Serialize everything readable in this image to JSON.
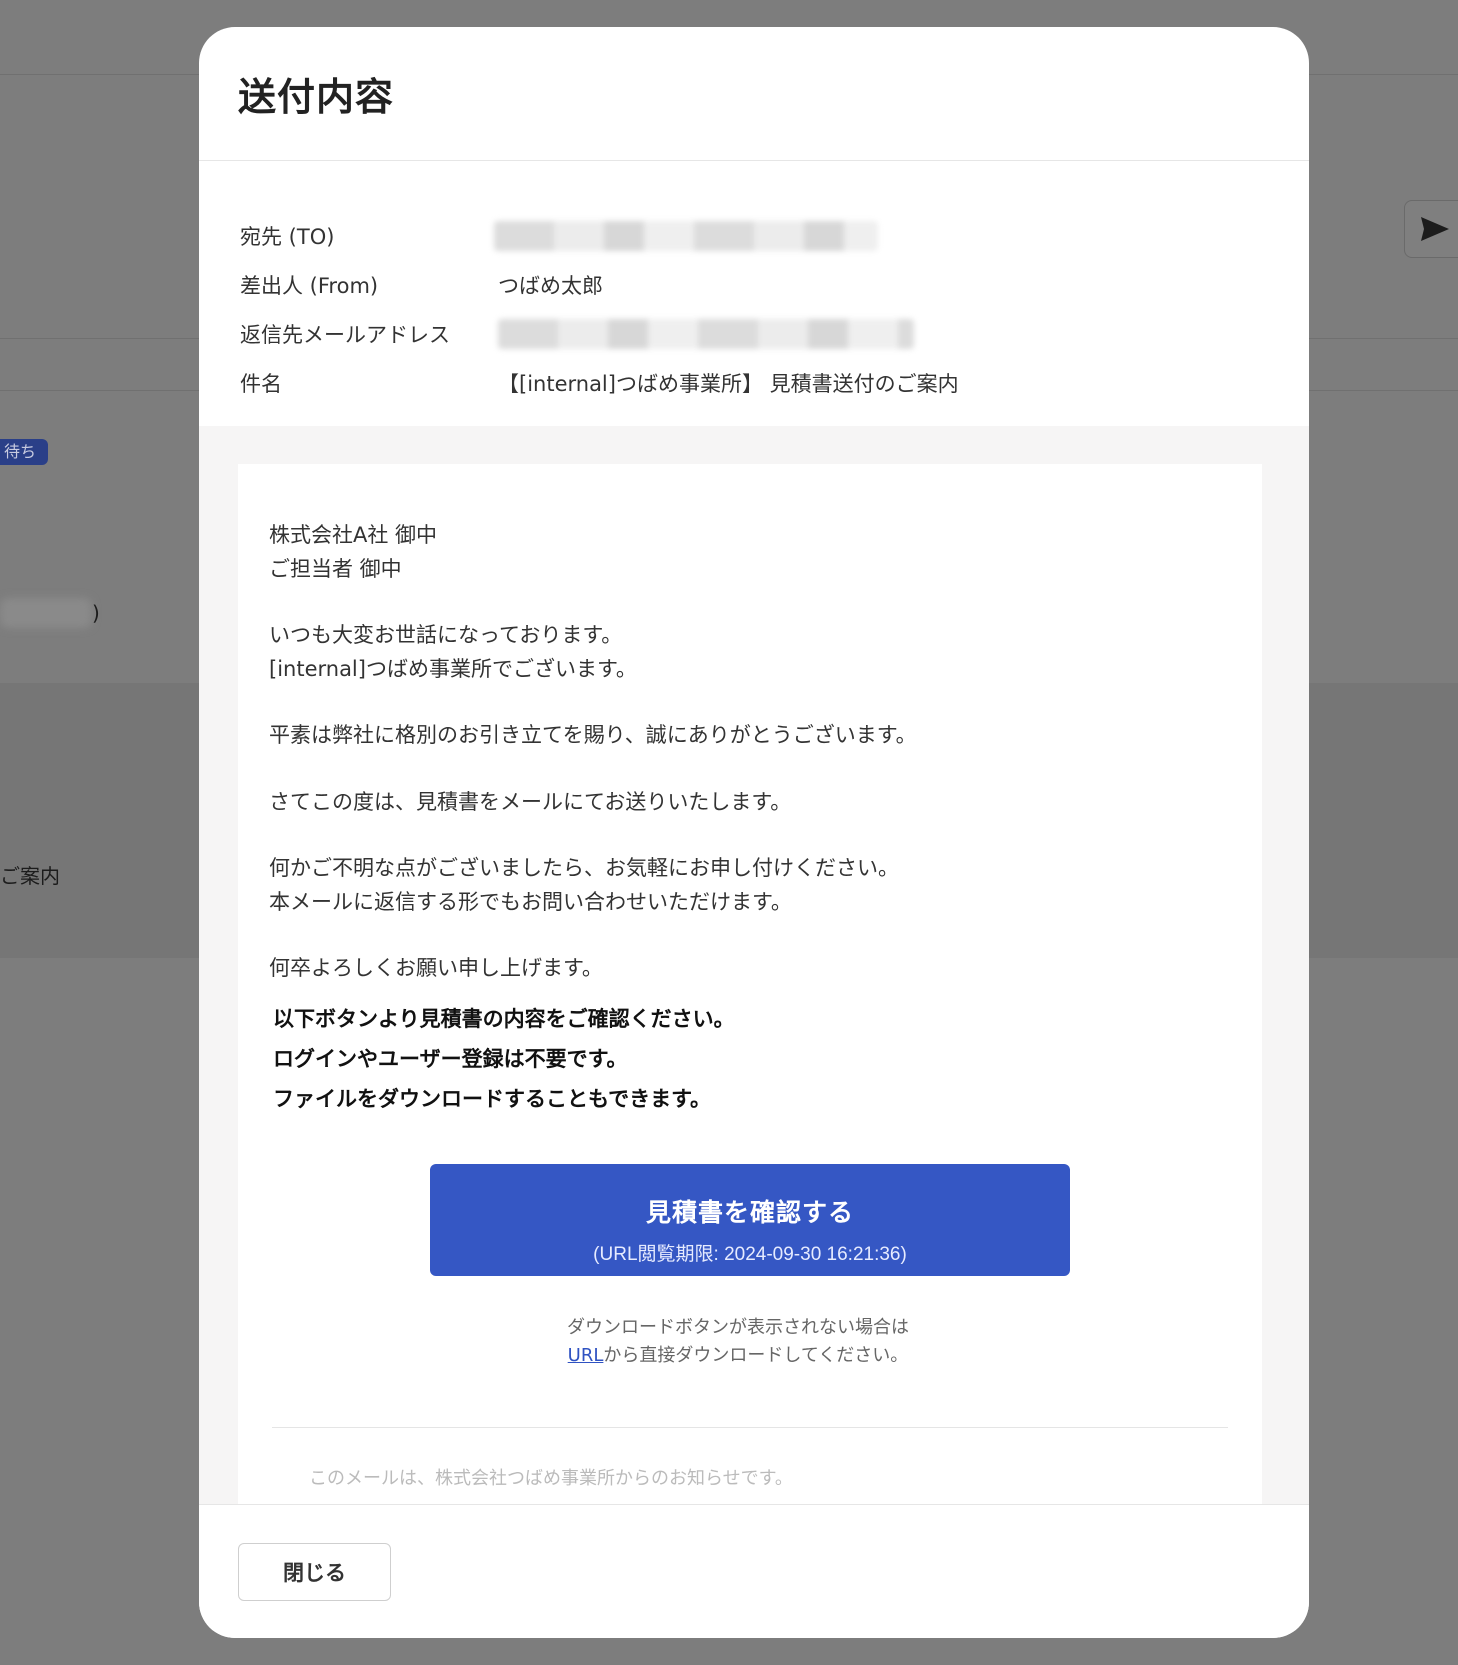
{
  "background": {
    "badge_label": "待ち",
    "paren": ")",
    "text_fragment": "ご案内"
  },
  "modal": {
    "title": "送付内容",
    "fields": [
      {
        "label": "宛先 (TO)",
        "value": ""
      },
      {
        "label": "差出人 (From)",
        "value": "つばめ太郎"
      },
      {
        "label": "返信先メールアドレス",
        "value": ""
      },
      {
        "label": "件名",
        "value": "【[internal]つばめ事業所】 見積書送付のご案内"
      }
    ],
    "email": {
      "greeting": [
        "株式会社A社 御中",
        "ご担当者 御中"
      ],
      "intro": [
        "いつも大変お世話になっております。",
        "[internal]つばめ事業所でございます。"
      ],
      "thanks": "平素は弊社に格別のお引き立てを賜り、誠にありがとうございます。",
      "main": "さてこの度は、見積書をメールにてお送りいたします。",
      "contact": [
        "何かご不明な点がございましたら、お気軽にお申し付けください。",
        "本メールに返信する形でもお問い合わせいただけます。"
      ],
      "closing": "何卒よろしくお願い申し上げます。",
      "instructions": [
        "以下ボタンより見積書の内容をご確認ください。",
        "ログインやユーザー登録は不要です。",
        "ファイルをダウンロードすることもできます。"
      ],
      "cta_label": "見積書を確認する",
      "cta_sub": "(URL閲覧期限: 2024-09-30 16:21:36)",
      "note_line1": "ダウンロードボタンが表示されない場合は",
      "note_link": "URL",
      "note_line2_rest": "から直接ダウンロードしてください。",
      "faded_footer": "このメールは、株式会社つばめ事業所からのお知らせです。"
    },
    "close_label": "閉じる"
  }
}
